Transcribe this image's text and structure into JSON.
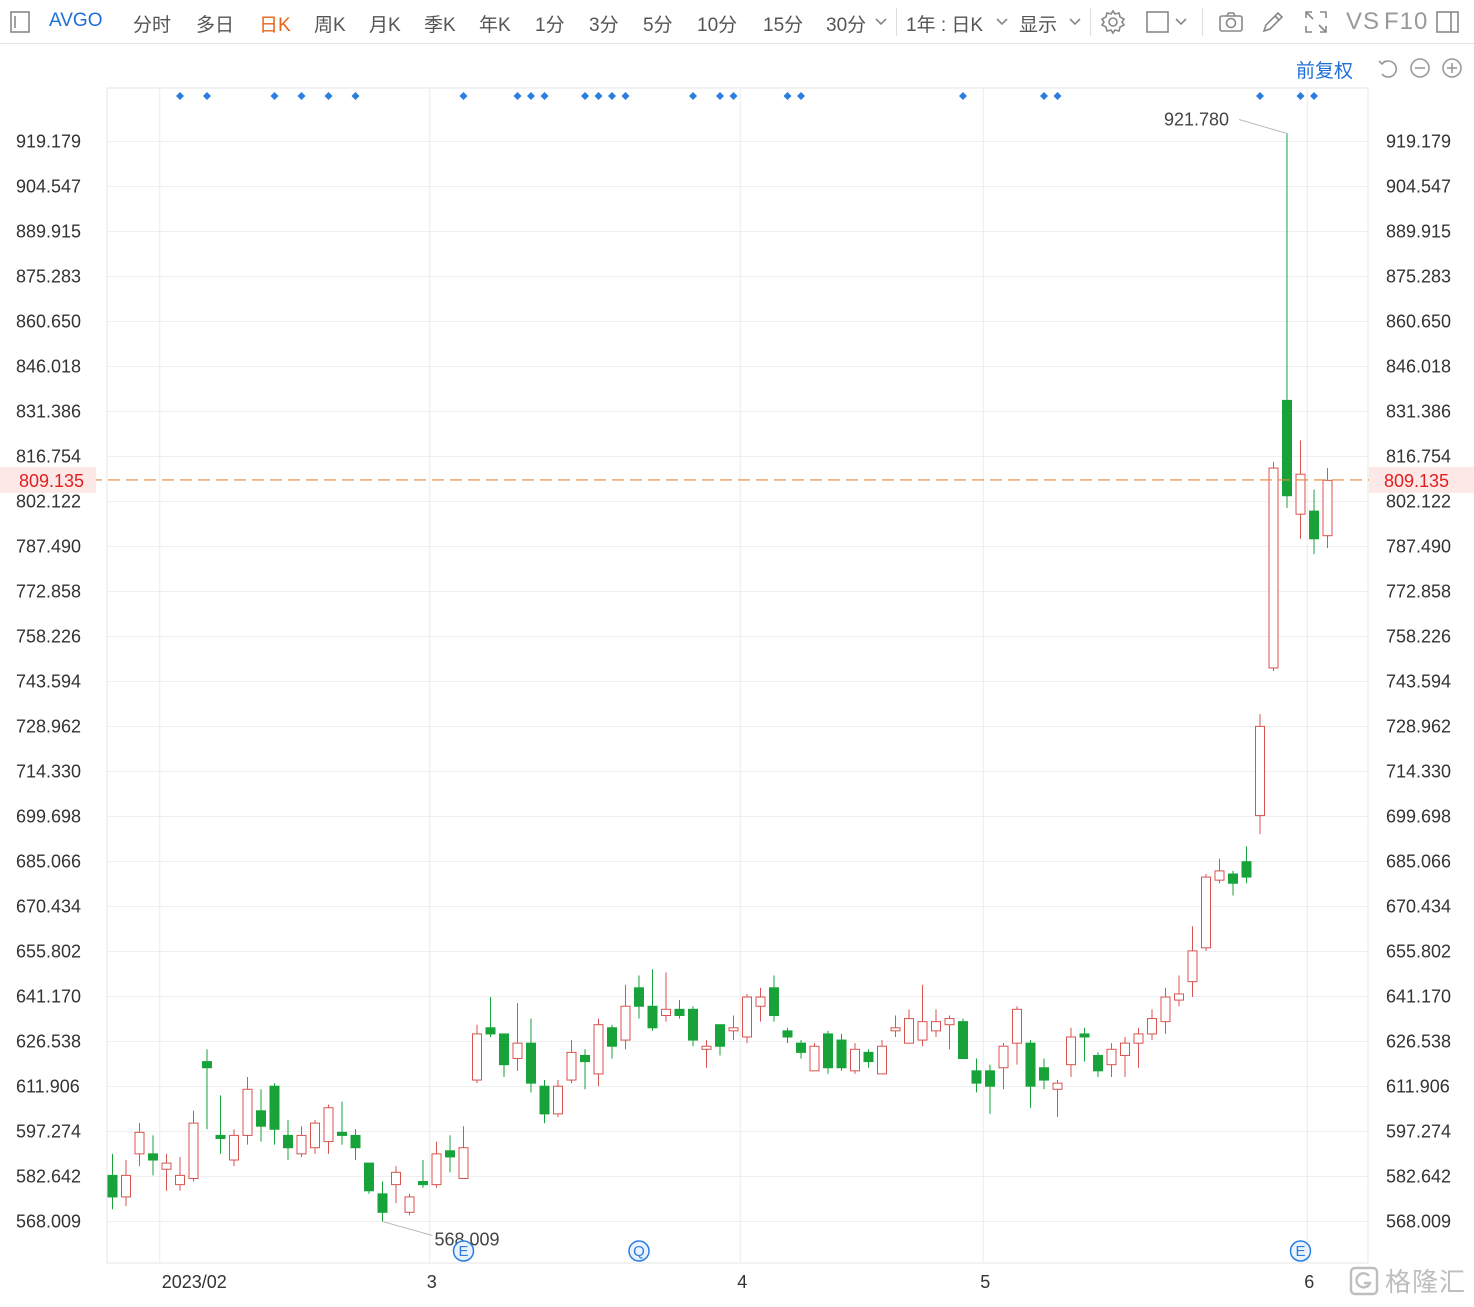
{
  "toolbar": {
    "ticker": "AVGO",
    "periods": [
      "分时",
      "多日",
      "日K",
      "周K",
      "月K",
      "季K",
      "年K",
      "1分",
      "3分",
      "5分",
      "10分",
      "15分",
      "30分"
    ],
    "active_period": "日K",
    "range_label": "1年 : 日K",
    "display_label": "显示",
    "vs_label": "VS",
    "f10_label": "F10",
    "icons": [
      "settings-icon",
      "layout-square-icon",
      "camera-icon",
      "pencil-icon",
      "fullscreen-icon",
      "panel-icon"
    ]
  },
  "chart_controls": {
    "adjust_label": "前复权",
    "icons": [
      "undo-icon",
      "zoom-out-icon",
      "zoom-in-icon"
    ]
  },
  "chart_data": {
    "type": "candlestick",
    "symbol": "AVGO",
    "y_ticks": [
      "919.179",
      "904.547",
      "889.915",
      "875.283",
      "860.650",
      "846.018",
      "831.386",
      "816.754",
      "802.122",
      "787.490",
      "772.858",
      "758.226",
      "743.594",
      "728.962",
      "714.330",
      "699.698",
      "685.066",
      "670.434",
      "655.802",
      "641.170",
      "626.538",
      "611.906",
      "597.274",
      "582.642",
      "568.009"
    ],
    "ylim": [
      561.7,
      925.3
    ],
    "x_labels": [
      "2023/02",
      "3",
      "4",
      "5",
      "6"
    ],
    "month_start_index": [
      4,
      24,
      47,
      65,
      89
    ],
    "current_price": "809.135",
    "max_label": "921.780",
    "max_index": 87,
    "min_label": "568.009",
    "min_index": 20,
    "up_color": "#d9534f",
    "down_color": "#17a33a",
    "current_line_color": "#e8863a",
    "marker_color": "#2a7de1",
    "dividend_marker_index": [
      5,
      7,
      12,
      14,
      16,
      18,
      26,
      30,
      31,
      32,
      35,
      36,
      37,
      38,
      43,
      45,
      46,
      50,
      51,
      63,
      69,
      70,
      85,
      88,
      89
    ],
    "events": [
      {
        "label": "E",
        "index": 26
      },
      {
        "label": "Q",
        "index": 39
      },
      {
        "label": "E",
        "index": 88
      }
    ],
    "candles": [
      [
        583,
        576,
        590,
        572
      ],
      [
        576,
        583,
        588,
        573
      ],
      [
        590,
        597,
        600,
        586
      ],
      [
        590,
        588,
        596,
        583
      ],
      [
        585,
        587,
        590,
        578
      ],
      [
        580,
        583,
        589,
        578
      ],
      [
        582,
        600,
        604,
        581
      ],
      [
        620,
        618,
        624,
        598
      ],
      [
        596,
        595,
        609,
        590
      ],
      [
        588,
        596,
        598,
        586
      ],
      [
        596,
        611,
        615,
        593
      ],
      [
        604,
        599,
        611,
        594
      ],
      [
        612,
        598,
        613,
        593
      ],
      [
        596,
        592,
        601,
        588
      ],
      [
        590,
        596,
        599,
        589
      ],
      [
        592,
        600,
        601,
        590
      ],
      [
        594,
        605,
        606,
        590
      ],
      [
        597,
        596,
        607,
        593
      ],
      [
        596,
        592,
        598,
        588
      ],
      [
        587,
        578,
        587,
        577
      ],
      [
        577,
        571,
        581,
        568
      ],
      [
        580,
        584,
        586,
        574
      ],
      [
        571,
        576,
        577,
        570
      ],
      [
        581,
        580,
        588,
        579
      ],
      [
        580,
        590,
        594,
        579
      ],
      [
        591,
        589,
        596,
        584
      ],
      [
        582,
        592,
        599,
        582
      ],
      [
        614,
        629,
        632,
        613
      ],
      [
        631,
        629,
        641,
        628
      ],
      [
        629,
        619,
        629,
        615
      ],
      [
        621,
        626,
        639,
        617
      ],
      [
        626,
        613,
        634,
        610
      ],
      [
        612,
        603,
        614,
        600
      ],
      [
        603,
        612,
        614,
        602
      ],
      [
        614,
        623,
        627,
        613
      ],
      [
        622,
        620,
        624,
        611
      ],
      [
        616,
        632,
        634,
        612
      ],
      [
        631,
        625,
        632,
        621
      ],
      [
        627,
        638,
        645,
        624
      ],
      [
        644,
        638,
        648,
        634
      ],
      [
        638,
        631,
        650,
        630
      ],
      [
        635,
        637,
        649,
        633
      ],
      [
        637,
        635,
        640,
        634
      ],
      [
        637,
        627,
        638,
        625
      ],
      [
        624,
        625,
        627,
        618
      ],
      [
        632,
        625,
        632,
        622
      ],
      [
        630,
        631,
        635,
        627
      ],
      [
        628,
        641,
        642,
        626
      ],
      [
        638,
        641,
        644,
        633
      ],
      [
        644,
        635,
        648,
        633
      ],
      [
        630,
        628,
        631,
        626
      ],
      [
        626,
        623,
        627,
        621
      ],
      [
        617,
        625,
        626,
        617
      ],
      [
        629,
        618,
        630,
        616
      ],
      [
        627,
        618,
        629,
        617
      ],
      [
        617,
        624,
        626,
        616
      ],
      [
        623,
        620,
        624,
        618
      ],
      [
        616,
        625,
        627,
        616
      ],
      [
        630,
        631,
        635,
        628
      ],
      [
        626,
        634,
        637,
        626
      ],
      [
        627,
        633,
        645,
        625
      ],
      [
        630,
        633,
        637,
        628
      ],
      [
        632,
        634,
        635,
        624
      ],
      [
        633,
        621,
        634,
        621
      ],
      [
        617,
        613,
        621,
        610
      ],
      [
        617,
        612,
        619,
        603
      ],
      [
        618,
        625,
        626,
        611
      ],
      [
        626,
        637,
        638,
        619
      ],
      [
        626,
        612,
        627,
        605
      ],
      [
        618,
        614,
        621,
        611
      ],
      [
        611,
        613,
        614,
        602
      ],
      [
        619,
        628,
        631,
        615
      ],
      [
        629,
        628,
        631,
        620
      ],
      [
        622,
        617,
        623,
        615
      ],
      [
        619,
        624,
        626,
        615
      ],
      [
        622,
        626,
        628,
        615
      ],
      [
        626,
        629,
        631,
        618
      ],
      [
        629,
        634,
        637,
        627
      ],
      [
        633,
        641,
        644,
        629
      ],
      [
        640,
        642,
        648,
        638
      ],
      [
        646,
        656,
        664,
        641
      ],
      [
        657,
        680,
        681,
        656
      ],
      [
        679,
        682,
        686,
        678
      ],
      [
        681,
        678,
        682,
        674
      ],
      [
        685,
        680,
        690,
        678
      ],
      [
        700,
        729,
        733,
        694
      ],
      [
        748,
        813,
        815,
        747
      ],
      [
        835,
        804,
        921.78,
        800
      ],
      [
        798,
        811,
        822,
        790
      ],
      [
        799,
        790,
        806,
        785
      ],
      [
        791,
        809,
        813,
        787
      ]
    ]
  },
  "watermark": {
    "text": "格隆汇"
  }
}
